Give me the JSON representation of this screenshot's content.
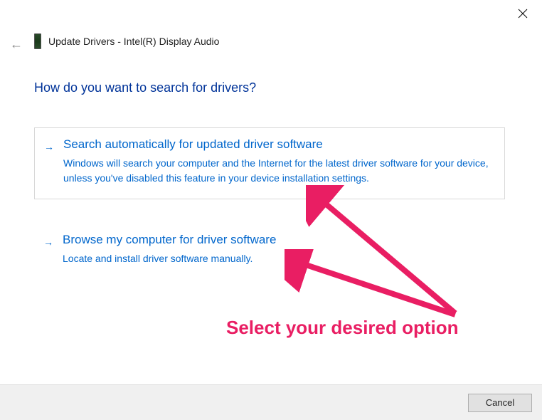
{
  "window": {
    "title": "Update Drivers - Intel(R) Display Audio"
  },
  "heading": "How do you want to search for drivers?",
  "options": [
    {
      "title": "Search automatically for updated driver software",
      "description": "Windows will search your computer and the Internet for the latest driver software for your device, unless you've disabled this feature in your device installation settings."
    },
    {
      "title": "Browse my computer for driver software",
      "description": "Locate and install driver software manually."
    }
  ],
  "annotation": {
    "text": "Select your desired option",
    "color": "#e91e63"
  },
  "footer": {
    "cancel_label": "Cancel"
  }
}
